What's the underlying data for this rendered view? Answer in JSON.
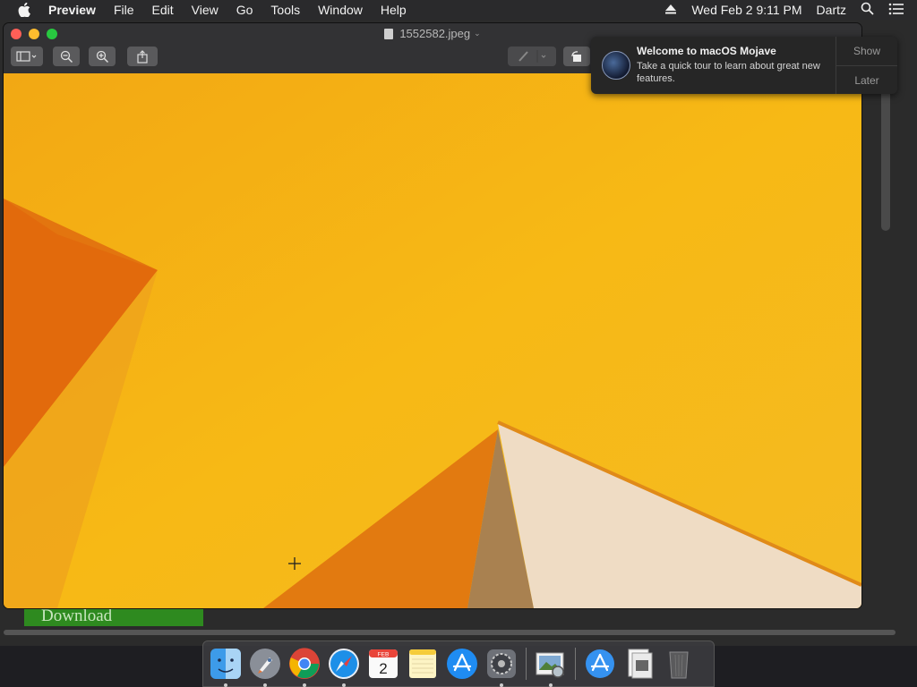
{
  "menubar": {
    "app_name": "Preview",
    "items": [
      "File",
      "Edit",
      "View",
      "Go",
      "Tools",
      "Window",
      "Help"
    ],
    "datetime": "Wed Feb 2  9:11 PM",
    "user": "Dartz"
  },
  "window": {
    "title": "1552582.jpeg"
  },
  "notification": {
    "title": "Welcome to macOS Mojave",
    "body": "Take a quick tour to learn about great new features.",
    "show_label": "Show",
    "later_label": "Later"
  },
  "background": {
    "download_label": "Download"
  },
  "dock": {
    "calendar_month": "FEB",
    "calendar_day": "2"
  },
  "colors": {
    "wallpaper_yellow": "#f5b416",
    "wallpaper_orange": "#e0680a",
    "wallpaper_cream": "#efdcc4"
  }
}
